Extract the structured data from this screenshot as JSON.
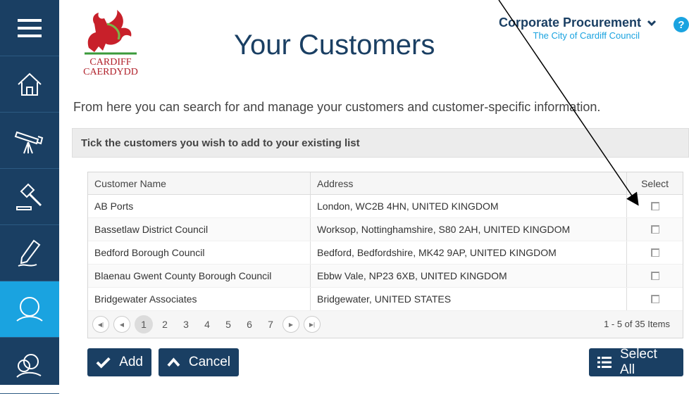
{
  "sidebar": {
    "items": [
      {
        "icon": "menu-icon"
      },
      {
        "icon": "home-icon"
      },
      {
        "icon": "telescope-icon"
      },
      {
        "icon": "gavel-icon"
      },
      {
        "icon": "pen-icon"
      },
      {
        "icon": "customer-search-icon",
        "active": true
      },
      {
        "icon": "people-search-icon"
      }
    ]
  },
  "header": {
    "logo_line1": "CARDIFF",
    "logo_line2": "CAERDYDD",
    "title": "Your Customers",
    "account_name": "Corporate Procurement",
    "account_org": "The City of Cardiff Council",
    "help": "?"
  },
  "intro": "From here you can search for and manage your customers and customer-specific information.",
  "panel": {
    "title": "Tick the customers you wish to add to your existing list"
  },
  "grid": {
    "columns": {
      "name": "Customer Name",
      "address": "Address",
      "select": "Select"
    },
    "rows": [
      {
        "name": "AB Ports",
        "address": "London, WC2B 4HN, UNITED KINGDOM"
      },
      {
        "name": "Bassetlaw District Council",
        "address": "Worksop, Nottinghamshire, S80 2AH, UNITED KINGDOM"
      },
      {
        "name": "Bedford Borough Council",
        "address": "Bedford, Bedfordshire, MK42 9AP, UNITED KINGDOM"
      },
      {
        "name": "Blaenau Gwent County Borough Council",
        "address": "Ebbw Vale, NP23 6XB, UNITED KINGDOM"
      },
      {
        "name": "Bridgewater Associates",
        "address": "Bridgewater, UNITED STATES"
      }
    ],
    "pager": {
      "pages": [
        "1",
        "2",
        "3",
        "4",
        "5",
        "6",
        "7"
      ],
      "current": "1",
      "info": "1 - 5 of 35 Items"
    }
  },
  "actions": {
    "add": "Add",
    "cancel": "Cancel",
    "select_all": "Select All"
  },
  "colors": {
    "sidebar": "#1a3f63",
    "accent": "#1aa3e0",
    "title": "#1a3f63"
  }
}
